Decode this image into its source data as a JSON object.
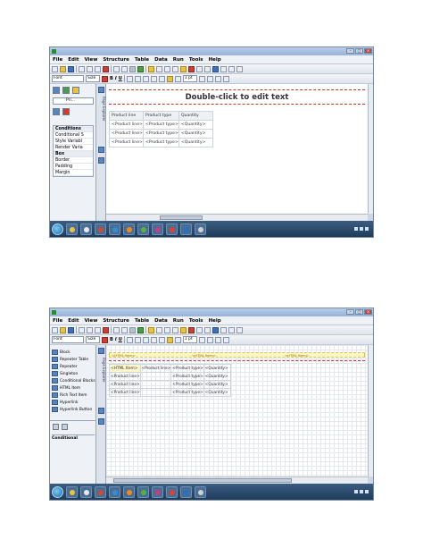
{
  "menu": [
    "File",
    "Edit",
    "View",
    "Structure",
    "Table",
    "Data",
    "Run",
    "Tools",
    "Help"
  ],
  "screenshot1": {
    "font_combo": "Font",
    "size_combo": "Size",
    "size_pt": "1 pt",
    "layout_select": "Pri...",
    "properties": [
      {
        "label": "Conditions",
        "group": true
      },
      {
        "label": "Conditional S",
        "group": false
      },
      {
        "label": "Style Variabl",
        "group": false
      },
      {
        "label": "Render Varia",
        "group": false
      },
      {
        "label": "Box",
        "group": true
      },
      {
        "label": "Border",
        "group": false
      },
      {
        "label": "Padding",
        "group": false
      },
      {
        "label": "Margin",
        "group": false
      }
    ],
    "doc_title": "Double-click to edit text",
    "table": {
      "headers": [
        "Product line",
        "Product type",
        "Quantity"
      ],
      "rows": [
        [
          "<Product line>",
          "<Product type>",
          "<Quantity>"
        ],
        [
          "<Product line>",
          "<Product type>",
          "<Quantity>"
        ],
        [
          "<Product line>",
          "<Product type>",
          "<Quantity>"
        ]
      ]
    },
    "vertical_tab": "Page Explorer"
  },
  "screenshot2": {
    "font_combo": "Font",
    "size_combo": "Size",
    "size_pt": "1 pt",
    "palette": [
      "Block",
      "Repeater Table",
      "Repeater",
      "Singleton",
      "Conditional Blocks",
      "HTML Item",
      "Rich Text Item",
      "Hyperlink",
      "Hyperlink Button"
    ],
    "conditional_label": "Conditional",
    "header_markers": [
      "<HTML Item>",
      "<HTML Item>",
      "<HTML Item>"
    ],
    "table": {
      "rows": [
        [
          "<HTML Item>",
          "<Product line>",
          "<Product type>",
          "<Quantity>"
        ],
        [
          "",
          "<Product line>",
          "<Product type>",
          "<Quantity>"
        ],
        [
          "",
          "<Product line>",
          "<Product type>",
          "<Quantity>"
        ],
        [
          "",
          "<Product line>",
          "<Product type>",
          "<Quantity>"
        ]
      ]
    },
    "vertical_tab": "Page Explorer"
  }
}
